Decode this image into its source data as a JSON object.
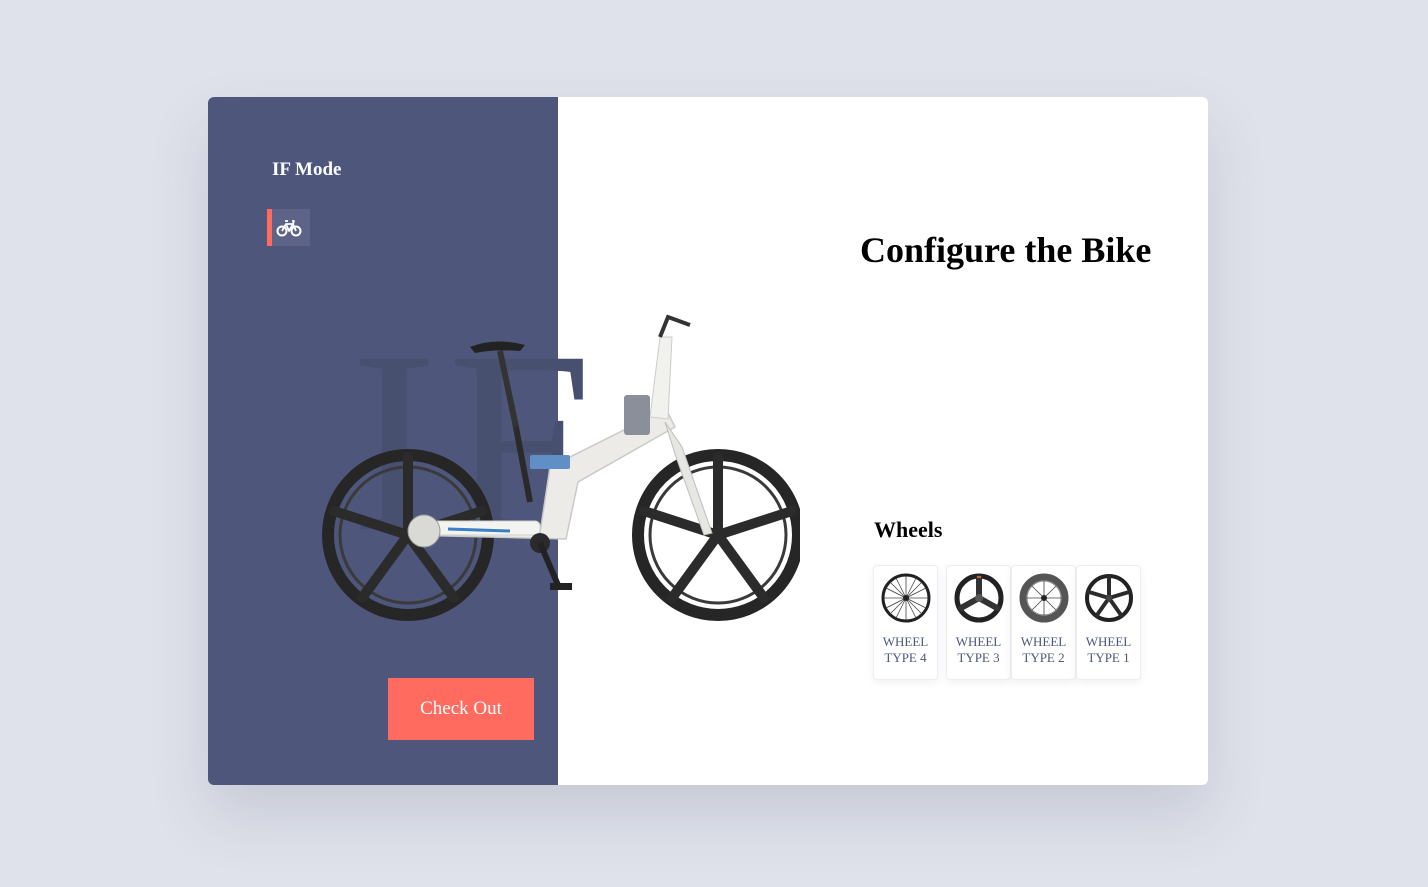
{
  "app": {
    "brand": "IF Mode"
  },
  "sidebar": {
    "items": [
      {
        "icon": "bicycle-icon",
        "active": true
      }
    ]
  },
  "watermark": "IF",
  "main": {
    "title": "Configure the Bike",
    "section_label": "Wheels",
    "wheel_options": [
      {
        "label_line1": "WHEEL",
        "label_line2": "TYPE 4",
        "icon": "spoked-wheel-icon"
      },
      {
        "label_line1": "WHEEL",
        "label_line2": "TYPE 3",
        "icon": "tri-spoke-wheel-icon"
      },
      {
        "label_line1": "WHEEL",
        "label_line2": "TYPE 2",
        "icon": "deep-rim-wheel-icon"
      },
      {
        "label_line1": "WHEEL",
        "label_line2": "TYPE 1",
        "icon": "five-spoke-wheel-icon"
      }
    ]
  },
  "actions": {
    "checkout_label": "Check Out"
  },
  "colors": {
    "sidebar_bg": "#4e567c",
    "accent": "#ff6b5e",
    "page_bg": "#dfe2ea"
  }
}
